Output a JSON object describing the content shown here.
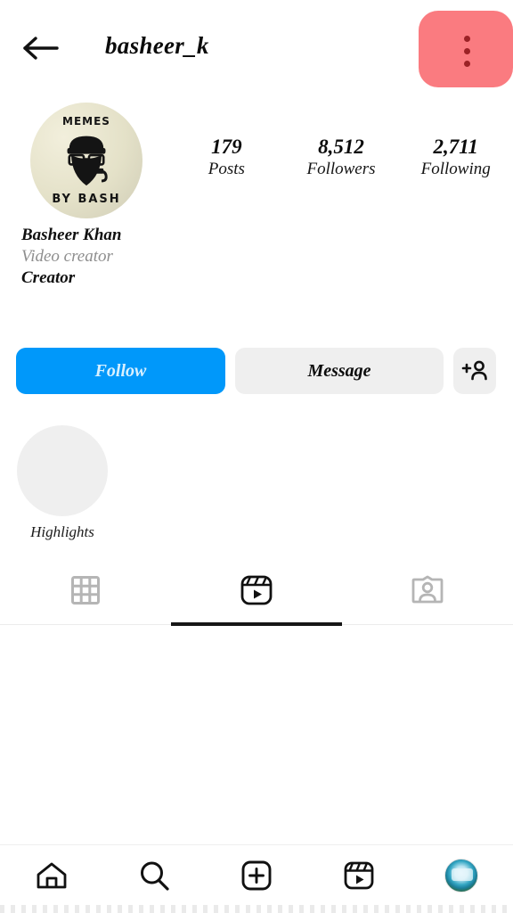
{
  "header": {
    "back_icon": "arrow-left-icon",
    "username": "basheer_k",
    "menu_icon": "more-vertical-icon",
    "menu_bg_color": "#FA7B80",
    "menu_dot_color": "#9b2226"
  },
  "profile": {
    "avatar": {
      "name": "profile-picture",
      "text_top": "MEMES",
      "text_bottom": "BY BASH",
      "bg_color": "#e9e7d2"
    },
    "stats": [
      {
        "value": "179",
        "label": "Posts"
      },
      {
        "value": "8,512",
        "label": "Followers"
      },
      {
        "value": "2,711",
        "label": "Following"
      }
    ],
    "bio": {
      "display_name": "Basheer Khan",
      "category": "Video creator",
      "role": "Creator"
    }
  },
  "actions": {
    "follow_label": "Follow",
    "follow_bg_color": "#0098FA",
    "follow_text_color": "#d7f0ff",
    "message_label": "Message",
    "message_bg_color": "#efefef",
    "adduser_icon": "add-person-icon"
  },
  "highlights": [
    {
      "label": "Highlights",
      "icon": "highlight-circle"
    }
  ],
  "tabs": [
    {
      "name": "grid",
      "icon": "grid-icon",
      "label": "Posts",
      "active": false
    },
    {
      "name": "reels",
      "icon": "reels-icon",
      "label": "Reels",
      "active": true
    },
    {
      "name": "tagged",
      "icon": "tagged-icon",
      "label": "Tagged",
      "active": false
    }
  ],
  "bottom_nav": [
    {
      "name": "home",
      "icon": "home-icon"
    },
    {
      "name": "search",
      "icon": "search-icon"
    },
    {
      "name": "create",
      "icon": "plus-box-icon"
    },
    {
      "name": "reels",
      "icon": "reels-icon"
    },
    {
      "name": "profile",
      "icon": "avatar-icon"
    }
  ]
}
